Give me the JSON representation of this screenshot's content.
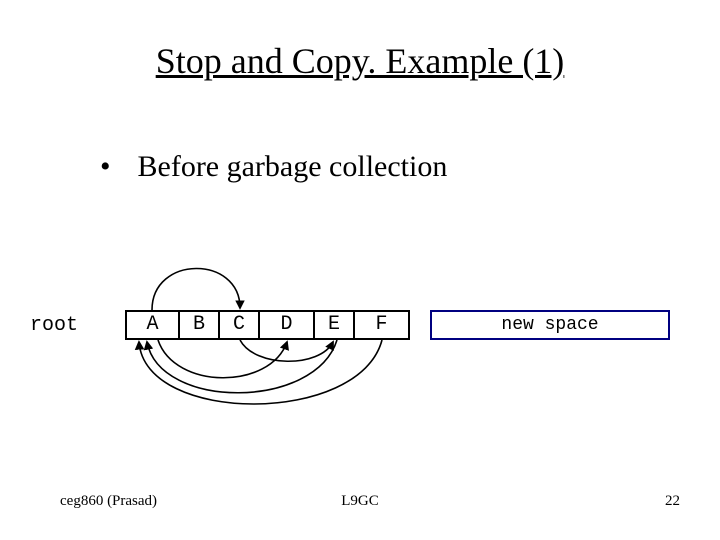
{
  "title": "Stop and Copy. Example (1)",
  "bullet": "Before garbage collection",
  "diagram": {
    "root_label": "root",
    "cells": [
      "A",
      "B",
      "C",
      "D",
      "E",
      "F"
    ],
    "new_space_label": "new space",
    "pointers": [
      {
        "from": "A",
        "to": "C",
        "side": "top"
      },
      {
        "from": "A",
        "to": "D",
        "side": "bottom"
      },
      {
        "from": "C",
        "to": "E",
        "side": "bottom"
      },
      {
        "from": "E",
        "to": "A",
        "side": "bottom"
      },
      {
        "from": "F",
        "to": "A",
        "side": "bottom"
      }
    ]
  },
  "footer": {
    "left": "ceg860 (Prasad)",
    "center": "L9GC",
    "right": "22"
  }
}
